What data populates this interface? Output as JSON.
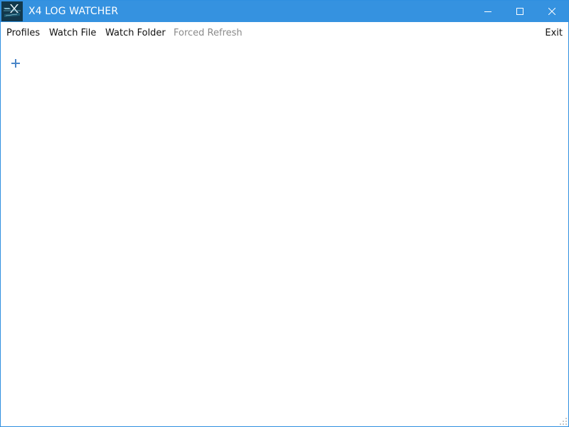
{
  "window": {
    "title": "X4 LOG WATCHER",
    "accent_color": "#3592e0",
    "app_icon": "x4-logo-icon",
    "controls": {
      "minimize_icon": "minimize-icon",
      "maximize_icon": "maximize-icon",
      "close_icon": "close-icon"
    }
  },
  "menu": {
    "profiles": "Profiles",
    "watch_file": "Watch File",
    "watch_folder": "Watch Folder",
    "forced_refresh": "Forced Refresh",
    "exit": "Exit"
  },
  "main": {
    "add_icon": "plus-icon",
    "add_icon_color": "#4a86c8"
  }
}
